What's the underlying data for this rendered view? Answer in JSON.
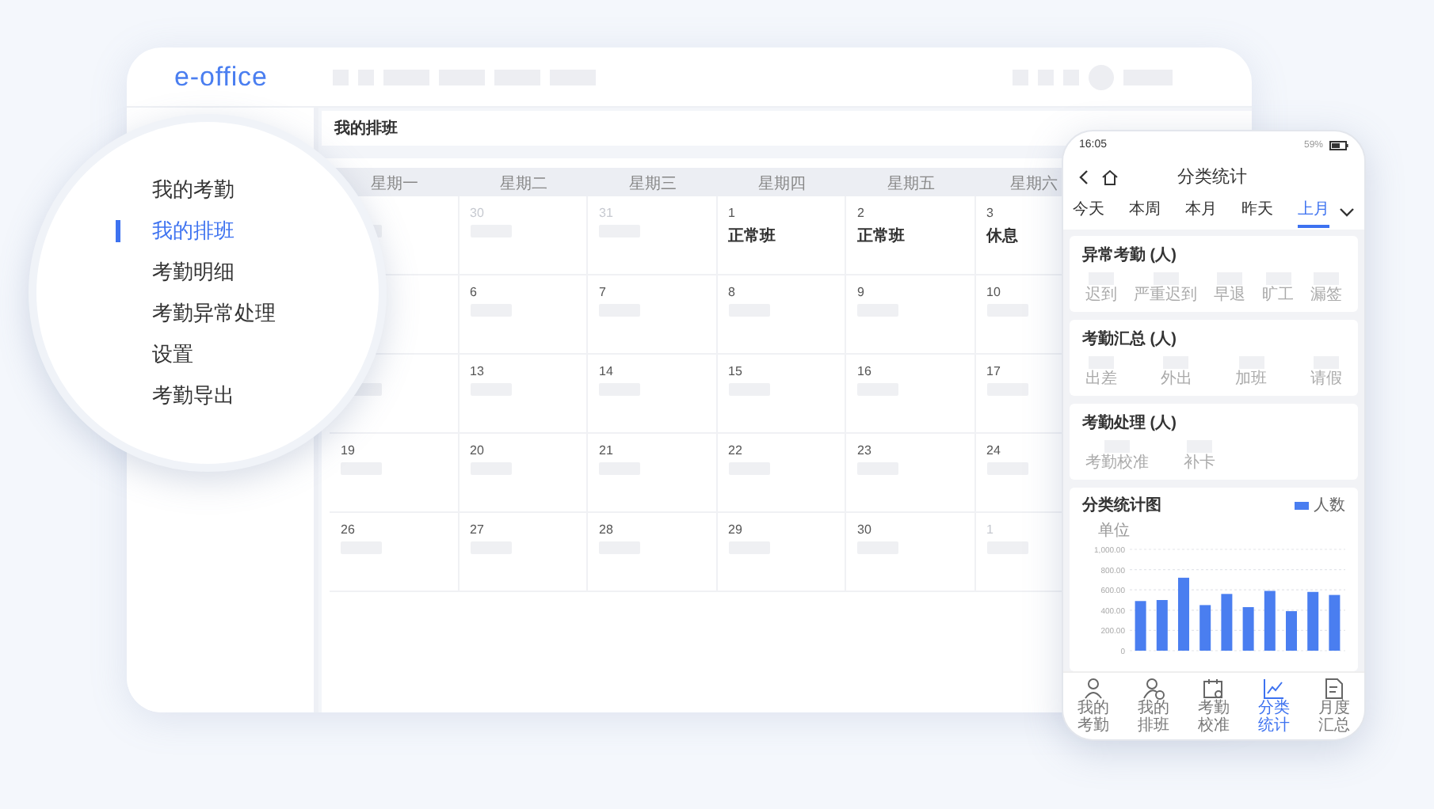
{
  "app": {
    "logo": "e-office"
  },
  "menu": [
    {
      "label": "我的考勤",
      "selected": false
    },
    {
      "label": "我的排班",
      "selected": true
    },
    {
      "label": "考勤明细",
      "selected": false
    },
    {
      "label": "考勤异常处理",
      "selected": false
    },
    {
      "label": "设置",
      "selected": false
    },
    {
      "label": "考勤导出",
      "selected": false
    }
  ],
  "page": {
    "title": "我的排班"
  },
  "calendar": {
    "weekdays": [
      "星期一",
      "星期二",
      "星期三",
      "星期四",
      "星期五",
      "星期六"
    ],
    "weeks": [
      [
        {
          "kind": "blank"
        },
        {
          "kind": "blank",
          "day": "30",
          "muted": true
        },
        {
          "kind": "blank",
          "day": "31",
          "muted": true
        },
        {
          "kind": "shift",
          "day": "1",
          "muted": false,
          "shift": "正常班"
        },
        {
          "kind": "shift",
          "day": "2",
          "muted": false,
          "shift": "正常班"
        },
        {
          "kind": "shift",
          "day": "3",
          "muted": false,
          "shift": "休息"
        }
      ],
      [
        {
          "kind": "blank"
        },
        {
          "kind": "blank",
          "day": "6",
          "muted": false
        },
        {
          "kind": "blank",
          "day": "7",
          "muted": false
        },
        {
          "kind": "blank",
          "day": "8",
          "muted": false
        },
        {
          "kind": "blank",
          "day": "9",
          "muted": false
        },
        {
          "kind": "blank",
          "day": "10",
          "muted": false
        }
      ],
      [
        {
          "kind": "blank"
        },
        {
          "kind": "blank",
          "day": "13",
          "muted": false
        },
        {
          "kind": "blank",
          "day": "14",
          "muted": false
        },
        {
          "kind": "blank",
          "day": "15",
          "muted": false
        },
        {
          "kind": "blank",
          "day": "16",
          "muted": false
        },
        {
          "kind": "blank",
          "day": "17",
          "muted": false
        }
      ],
      [
        {
          "kind": "blank",
          "day": "19",
          "muted": false
        },
        {
          "kind": "blank",
          "day": "20",
          "muted": false
        },
        {
          "kind": "blank",
          "day": "21",
          "muted": false
        },
        {
          "kind": "blank",
          "day": "22",
          "muted": false
        },
        {
          "kind": "blank",
          "day": "23",
          "muted": false
        },
        {
          "kind": "blank",
          "day": "24",
          "muted": false
        }
      ],
      [
        {
          "kind": "blank",
          "day": "26",
          "muted": false
        },
        {
          "kind": "blank",
          "day": "27",
          "muted": false
        },
        {
          "kind": "blank",
          "day": "28",
          "muted": false
        },
        {
          "kind": "blank",
          "day": "29",
          "muted": false
        },
        {
          "kind": "blank",
          "day": "30",
          "muted": false
        },
        {
          "kind": "blank",
          "day": "1",
          "muted": true
        }
      ]
    ]
  },
  "phone": {
    "status": {
      "time": "16:05",
      "battery": "59%"
    },
    "title": "分类统计",
    "tabs": [
      {
        "label": "今天",
        "selected": false
      },
      {
        "label": "本周",
        "selected": false
      },
      {
        "label": "本月",
        "selected": false
      },
      {
        "label": "昨天",
        "selected": false
      },
      {
        "label": "上月",
        "selected": true
      }
    ],
    "sections": [
      {
        "title": "异常考勤 (人)",
        "items": [
          "迟到",
          "严重迟到",
          "早退",
          "旷工",
          "漏签"
        ]
      },
      {
        "title": "考勤汇总 (人)",
        "items": [
          "出差",
          "外出",
          "加班",
          "请假"
        ]
      },
      {
        "title": "考勤处理 (人)",
        "items": [
          "考勤校准",
          "补卡"
        ]
      }
    ],
    "chart": {
      "title": "分类统计图",
      "chart_data": {
        "type": "bar",
        "ylabel": "单位",
        "ylim": [
          0,
          1000
        ],
        "grid": true,
        "yticks": [
          {
            "value": 0,
            "label": "0"
          },
          {
            "value": 200,
            "label": "200.00"
          },
          {
            "value": 400,
            "label": "400.00"
          },
          {
            "value": 600,
            "label": "600.00"
          },
          {
            "value": 800,
            "label": "800.00"
          },
          {
            "value": 1000,
            "label": "1,000.00"
          }
        ],
        "series": [
          {
            "name": "人数",
            "color": "#4a7ef0",
            "values": [
              490,
              500,
              720,
              450,
              560,
              430,
              590,
              390,
              580,
              550
            ]
          }
        ]
      }
    },
    "bottom_nav": [
      {
        "label": "我的考勤",
        "selected": false,
        "kind": "person"
      },
      {
        "label": "我的排班",
        "selected": false,
        "kind": "person-clock"
      },
      {
        "label": "考勤校准",
        "selected": false,
        "kind": "calendar"
      },
      {
        "label": "分类统计",
        "selected": true,
        "kind": "chart"
      },
      {
        "label": "月度汇总",
        "selected": false,
        "kind": "document"
      }
    ]
  }
}
